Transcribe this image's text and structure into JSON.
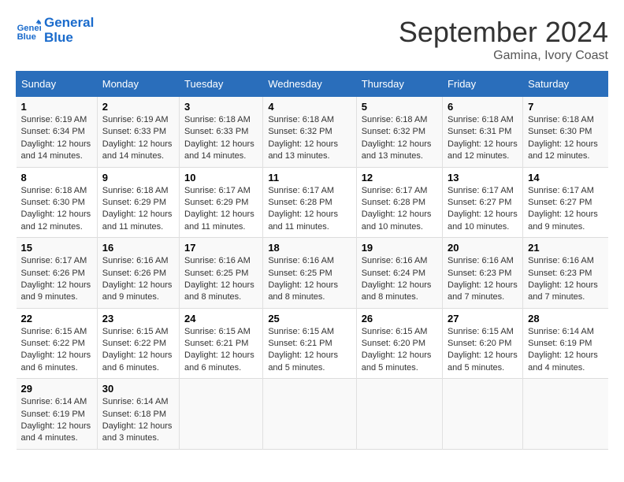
{
  "header": {
    "logo_line1": "General",
    "logo_line2": "Blue",
    "month": "September 2024",
    "location": "Gamina, Ivory Coast"
  },
  "weekdays": [
    "Sunday",
    "Monday",
    "Tuesday",
    "Wednesday",
    "Thursday",
    "Friday",
    "Saturday"
  ],
  "weeks": [
    [
      {
        "day": "1",
        "sunrise": "6:19 AM",
        "sunset": "6:34 PM",
        "daylight": "12 hours and 14 minutes."
      },
      {
        "day": "2",
        "sunrise": "6:19 AM",
        "sunset": "6:33 PM",
        "daylight": "12 hours and 14 minutes."
      },
      {
        "day": "3",
        "sunrise": "6:18 AM",
        "sunset": "6:33 PM",
        "daylight": "12 hours and 14 minutes."
      },
      {
        "day": "4",
        "sunrise": "6:18 AM",
        "sunset": "6:32 PM",
        "daylight": "12 hours and 13 minutes."
      },
      {
        "day": "5",
        "sunrise": "6:18 AM",
        "sunset": "6:32 PM",
        "daylight": "12 hours and 13 minutes."
      },
      {
        "day": "6",
        "sunrise": "6:18 AM",
        "sunset": "6:31 PM",
        "daylight": "12 hours and 12 minutes."
      },
      {
        "day": "7",
        "sunrise": "6:18 AM",
        "sunset": "6:30 PM",
        "daylight": "12 hours and 12 minutes."
      }
    ],
    [
      {
        "day": "8",
        "sunrise": "6:18 AM",
        "sunset": "6:30 PM",
        "daylight": "12 hours and 12 minutes."
      },
      {
        "day": "9",
        "sunrise": "6:18 AM",
        "sunset": "6:29 PM",
        "daylight": "12 hours and 11 minutes."
      },
      {
        "day": "10",
        "sunrise": "6:17 AM",
        "sunset": "6:29 PM",
        "daylight": "12 hours and 11 minutes."
      },
      {
        "day": "11",
        "sunrise": "6:17 AM",
        "sunset": "6:28 PM",
        "daylight": "12 hours and 11 minutes."
      },
      {
        "day": "12",
        "sunrise": "6:17 AM",
        "sunset": "6:28 PM",
        "daylight": "12 hours and 10 minutes."
      },
      {
        "day": "13",
        "sunrise": "6:17 AM",
        "sunset": "6:27 PM",
        "daylight": "12 hours and 10 minutes."
      },
      {
        "day": "14",
        "sunrise": "6:17 AM",
        "sunset": "6:27 PM",
        "daylight": "12 hours and 9 minutes."
      }
    ],
    [
      {
        "day": "15",
        "sunrise": "6:17 AM",
        "sunset": "6:26 PM",
        "daylight": "12 hours and 9 minutes."
      },
      {
        "day": "16",
        "sunrise": "6:16 AM",
        "sunset": "6:26 PM",
        "daylight": "12 hours and 9 minutes."
      },
      {
        "day": "17",
        "sunrise": "6:16 AM",
        "sunset": "6:25 PM",
        "daylight": "12 hours and 8 minutes."
      },
      {
        "day": "18",
        "sunrise": "6:16 AM",
        "sunset": "6:25 PM",
        "daylight": "12 hours and 8 minutes."
      },
      {
        "day": "19",
        "sunrise": "6:16 AM",
        "sunset": "6:24 PM",
        "daylight": "12 hours and 8 minutes."
      },
      {
        "day": "20",
        "sunrise": "6:16 AM",
        "sunset": "6:23 PM",
        "daylight": "12 hours and 7 minutes."
      },
      {
        "day": "21",
        "sunrise": "6:16 AM",
        "sunset": "6:23 PM",
        "daylight": "12 hours and 7 minutes."
      }
    ],
    [
      {
        "day": "22",
        "sunrise": "6:15 AM",
        "sunset": "6:22 PM",
        "daylight": "12 hours and 6 minutes."
      },
      {
        "day": "23",
        "sunrise": "6:15 AM",
        "sunset": "6:22 PM",
        "daylight": "12 hours and 6 minutes."
      },
      {
        "day": "24",
        "sunrise": "6:15 AM",
        "sunset": "6:21 PM",
        "daylight": "12 hours and 6 minutes."
      },
      {
        "day": "25",
        "sunrise": "6:15 AM",
        "sunset": "6:21 PM",
        "daylight": "12 hours and 5 minutes."
      },
      {
        "day": "26",
        "sunrise": "6:15 AM",
        "sunset": "6:20 PM",
        "daylight": "12 hours and 5 minutes."
      },
      {
        "day": "27",
        "sunrise": "6:15 AM",
        "sunset": "6:20 PM",
        "daylight": "12 hours and 5 minutes."
      },
      {
        "day": "28",
        "sunrise": "6:14 AM",
        "sunset": "6:19 PM",
        "daylight": "12 hours and 4 minutes."
      }
    ],
    [
      {
        "day": "29",
        "sunrise": "6:14 AM",
        "sunset": "6:19 PM",
        "daylight": "12 hours and 4 minutes."
      },
      {
        "day": "30",
        "sunrise": "6:14 AM",
        "sunset": "6:18 PM",
        "daylight": "12 hours and 3 minutes."
      },
      null,
      null,
      null,
      null,
      null
    ]
  ]
}
